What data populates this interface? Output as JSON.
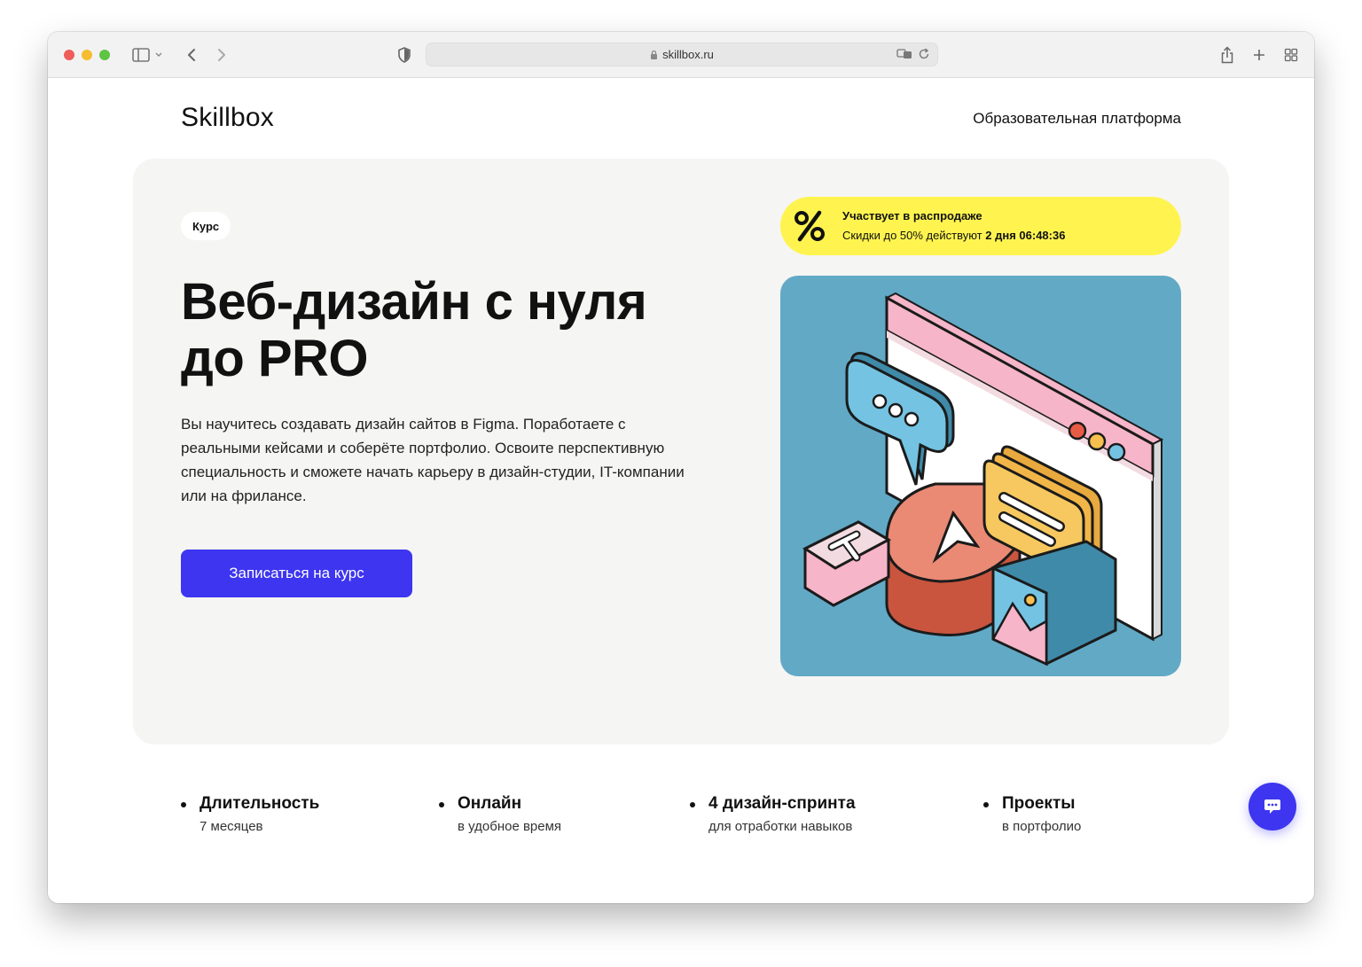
{
  "browser": {
    "url": "skillbox.ru"
  },
  "header": {
    "logo": "Skillbox",
    "nav_text": "Образовательная платформа"
  },
  "hero": {
    "badge": "Курс",
    "title_line1": "Веб-дизайн с нуля",
    "title_line2": "до PRO",
    "description": "Вы научитесь создавать дизайн сайтов в Figma. Поработаете с реальными кейсами и соберёте портфолио. Освоите перспективную специальность и сможете начать карьеру в дизайн-студии, IT-компании или на фрилансе.",
    "cta_label": "Записаться на курс"
  },
  "sale": {
    "title": "Участвует в распродаже",
    "text_prefix": "Скидки до 50% действуют",
    "days": "2 дня",
    "timer": "06:48:36"
  },
  "features": [
    {
      "title": "Длительность",
      "subtitle": "7 месяцев"
    },
    {
      "title": "Онлайн",
      "subtitle": "в удобное время"
    },
    {
      "title": "4 дизайн-спринта",
      "subtitle": "для отработки навыков"
    },
    {
      "title": "Проекты",
      "subtitle": "в портфолио"
    }
  ],
  "colors": {
    "accent": "#3d35f0",
    "sale_bg": "#fff44f",
    "hero_bg": "#f5f5f3",
    "illustration_bg": "#62a9c6"
  },
  "icons": [
    "sidebar-toggle-icon",
    "back-icon",
    "forward-icon",
    "shield-icon",
    "lock-icon",
    "translate-icon",
    "reload-icon",
    "share-icon",
    "plus-icon",
    "tabs-overview-icon",
    "percent-icon",
    "chat-icon"
  ]
}
